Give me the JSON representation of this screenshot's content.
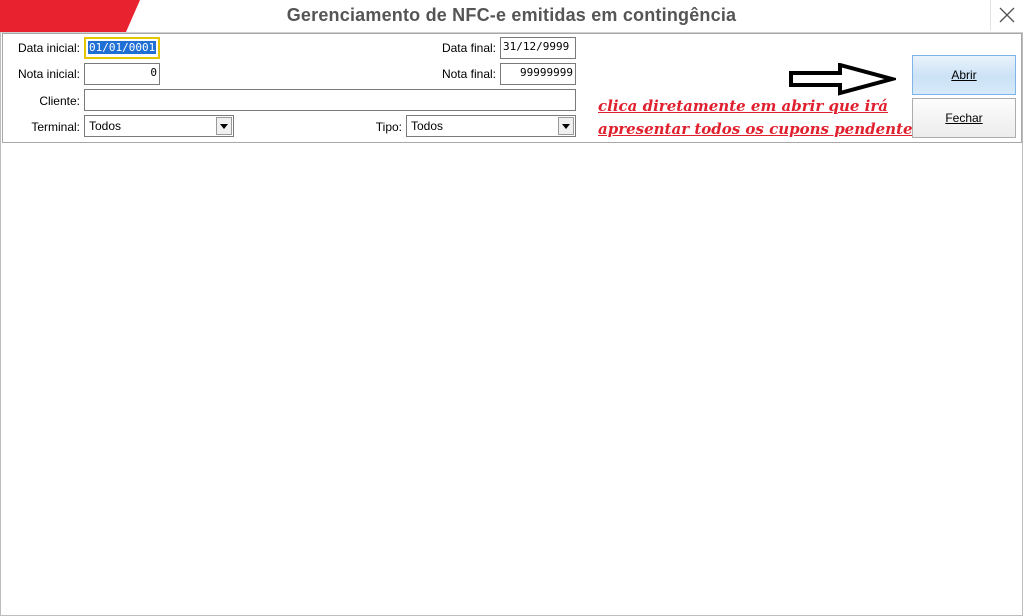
{
  "window": {
    "title": "Gerenciamento de NFC-e emitidas em contingência",
    "accent_color": "#e8222e",
    "close_icon": "close-icon"
  },
  "form": {
    "data_inicial": {
      "label": "Data inicial:",
      "value": "01/01/0001"
    },
    "data_final": {
      "label": "Data final:",
      "value": "31/12/9999"
    },
    "nota_inicial": {
      "label": "Nota inicial:",
      "value": "0"
    },
    "nota_final": {
      "label": "Nota final:",
      "value": "99999999"
    },
    "cliente": {
      "label": "Cliente:",
      "value": ""
    },
    "terminal": {
      "label": "Terminal:",
      "value": "Todos"
    },
    "tipo": {
      "label": "Tipo:",
      "value": "Todos"
    }
  },
  "buttons": {
    "abrir": "Abrir",
    "fechar": "Fechar"
  },
  "annotation": {
    "line1": "clica diretamente em abrir que irá",
    "line2": "apresentar todos os cupons pendentes",
    "color": "#e0202e",
    "arrow_icon": "right-arrow-icon"
  }
}
